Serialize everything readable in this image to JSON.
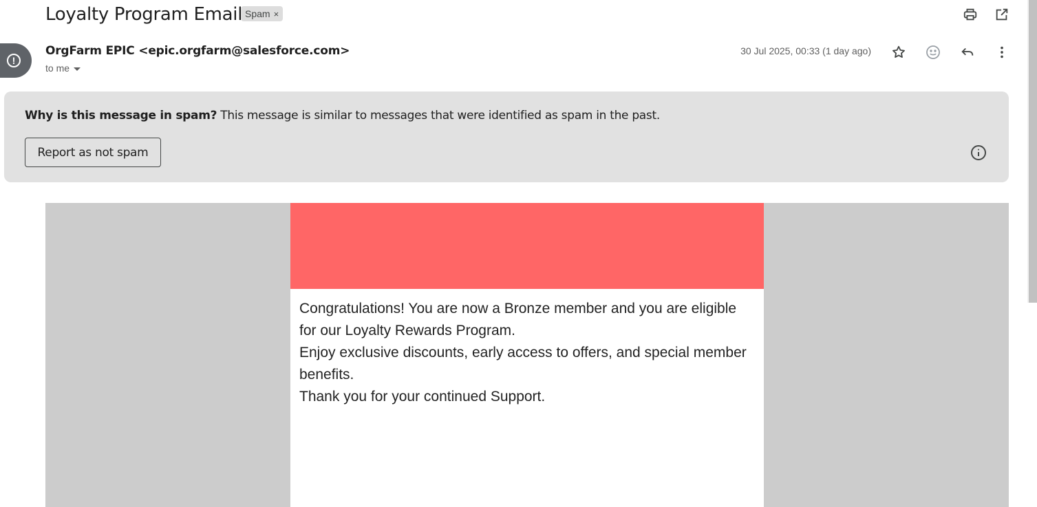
{
  "header": {
    "subject": "Loyalty Program Email",
    "spam_label": "Spam",
    "spam_remove": "×"
  },
  "toolbar": {
    "icons": [
      "print-icon",
      "open-in-new-window-icon"
    ]
  },
  "message": {
    "sender": "OrgFarm EPIC <epic.orgfarm@salesforce.com>",
    "recipient": "to me",
    "date": "30 Jul 2025, 00:33 (1 day ago)",
    "action_icons": [
      "star-icon",
      "emoji-icon",
      "reply-icon",
      "more-vert-icon"
    ]
  },
  "spam_banner": {
    "question": "Why is this message in spam?",
    "explanation": "This message is similar to messages that were identified as spam in the past.",
    "report_button": "Report as not spam",
    "info_icon": "info-icon"
  },
  "email_body": {
    "banner_color": "#ff6666",
    "paragraphs": [
      "Congratulations! You are now a Bronze member and you are eligible for our Loyalty Rewards Program.",
      "Enjoy exclusive discounts, early access to offers, and special member benefits.",
      "Thank you for your continued Support."
    ]
  }
}
